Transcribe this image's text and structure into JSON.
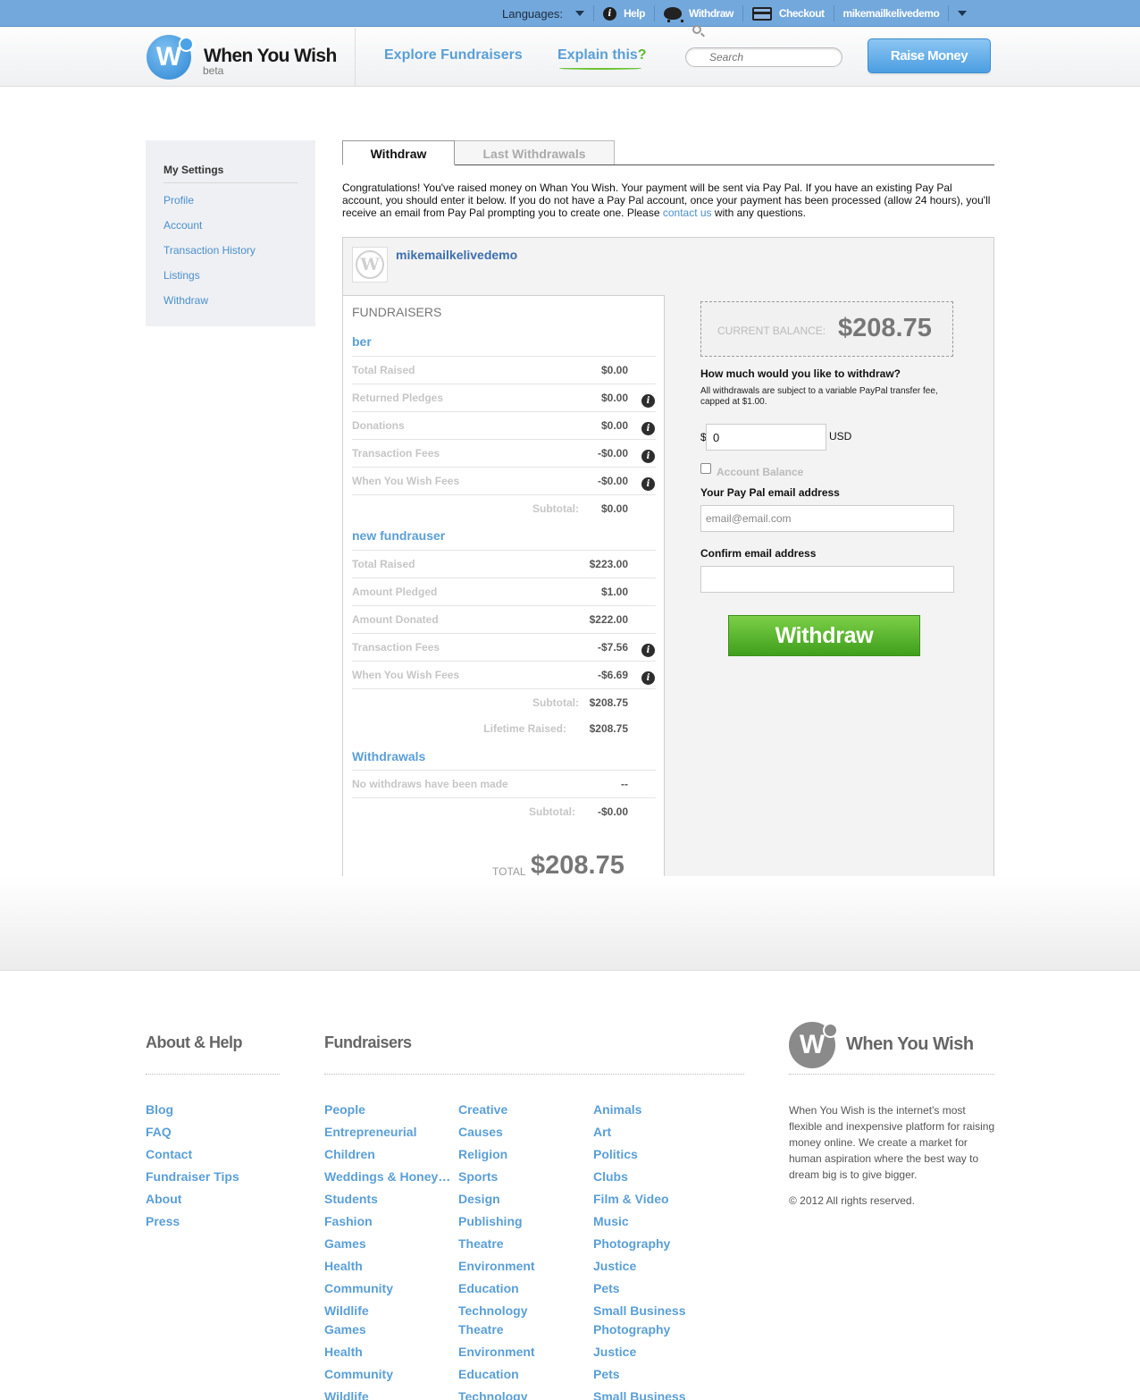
{
  "topbar": {
    "languages_label": "Languages:",
    "help": "Help",
    "withdraw": "Withdraw",
    "checkout": "Checkout",
    "username": "mikemailkelivedemo"
  },
  "header": {
    "logo_text": "When You Wish",
    "logo_beta": "beta",
    "explore": "Explore Fundraisers",
    "explain": "Explain this",
    "explain_q": "?",
    "search_placeholder": "Search",
    "raise_money": "Raise Money"
  },
  "sidebar": {
    "title": "My Settings",
    "items": [
      "Profile",
      "Account",
      "Transaction History",
      "Listings",
      "Withdraw"
    ]
  },
  "tabs": {
    "active": "Withdraw",
    "inactive": "Last Withdrawals"
  },
  "intro": {
    "text1": "Congratulations! You've raised money on Whan You Wish. Your payment will be sent via Pay Pal. If you have an existing Pay Pal account, you should enter it below. If you do not have a Pay Pal account, once your payment has been processed (allow 24 hours), you'll receive an email from Pay Pal prompting you to create one. Please ",
    "link": "contact us",
    "text2": " with any questions."
  },
  "account": {
    "username": "mikemailkelivedemo"
  },
  "fundraisers": {
    "header": "FUNDRAISERS",
    "f1": {
      "name": "ber",
      "rows": [
        {
          "label": "Total Raised",
          "value": "$0.00"
        },
        {
          "label": "Returned Pledges",
          "value": "$0.00"
        },
        {
          "label": "Donations",
          "value": "$0.00"
        },
        {
          "label": "Transaction Fees",
          "value": "-$0.00"
        },
        {
          "label": "When You Wish Fees",
          "value": "-$0.00"
        }
      ],
      "subtotal_label": "Subtotal:",
      "subtotal": "$0.00"
    },
    "f2": {
      "name": "new fundrauser",
      "rows": [
        {
          "label": "Total Raised",
          "value": "$223.00"
        },
        {
          "label": "Amount Pledged",
          "value": "$1.00"
        },
        {
          "label": "Amount Donated",
          "value": "$222.00"
        },
        {
          "label": "Transaction Fees",
          "value": "-$7.56"
        },
        {
          "label": "When You Wish Fees",
          "value": "-$6.69"
        }
      ],
      "subtotal_label": "Subtotal:",
      "subtotal": "$208.75",
      "lifetime_label": "Lifetime Raised:",
      "lifetime": "$208.75"
    },
    "withdrawals": {
      "name": "Withdrawals",
      "row_label": "No withdraws have been made",
      "row_value": "--",
      "subtotal_label": "Subtotal:",
      "subtotal": "-$0.00"
    },
    "total_label": "TOTAL",
    "total": "$208.75"
  },
  "withdraw_form": {
    "balance_label": "CURRENT BALANCE:",
    "balance": "$208.75",
    "question": "How much would you like to withdraw?",
    "fee_note": "All withdrawals are subject to a variable PayPal transfer fee, capped at $1.00.",
    "currency_symbol": "$",
    "amount": "0",
    "currency": "USD",
    "checkbox_label": "Account Balance",
    "email_label": "Your Pay Pal email address",
    "email_placeholder": "email@email.com",
    "confirm_label": "Confirm email address",
    "button": "Withdraw"
  },
  "footer": {
    "about_title": "About & Help",
    "about_links": [
      "Blog",
      "FAQ",
      "Contact",
      "Fundraiser Tips",
      "About",
      "Press"
    ],
    "fund_title": "Fundraisers",
    "col1": [
      "People",
      "Entrepreneurial",
      "Children",
      "Weddings & Honey…",
      "Students",
      "Fashion",
      "Games",
      "Health",
      "Community",
      "Wildlife",
      "Games",
      "Health",
      "Community",
      "Wildlife"
    ],
    "col2": [
      "Creative",
      "Causes",
      "Religion",
      "Sports",
      "Design",
      "Publishing",
      "Theatre",
      "Environment",
      "Education",
      "Technology",
      "Theatre",
      "Environment",
      "Education",
      "Technology"
    ],
    "col3": [
      "Animals",
      "Art",
      "Politics",
      "Clubs",
      "Film & Video",
      "Music",
      "Photography",
      "Justice",
      "Pets",
      "Small Business",
      "Photography",
      "Justice",
      "Pets",
      "Small Business"
    ],
    "logo_text": "When You Wish",
    "about_text": "When You Wish is the internet's most flexible and inexpensive platform for raising money online. We create a market for human aspiration where the best way to dream big is to give bigger.",
    "copyright": "© 2012 All rights reserved."
  }
}
